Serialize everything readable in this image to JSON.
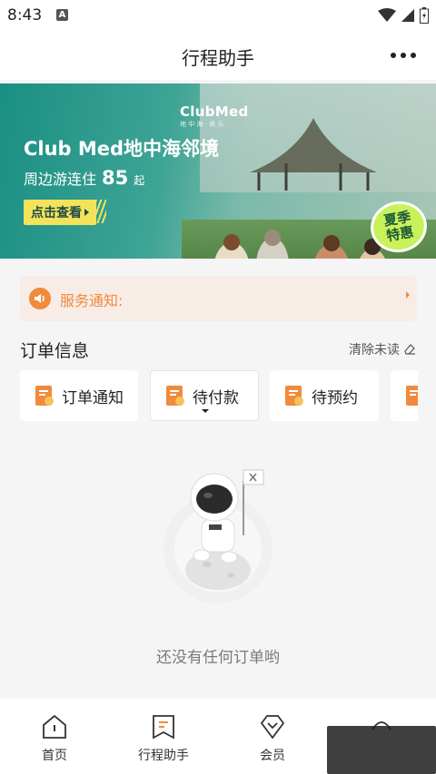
{
  "status_bar": {
    "time": "8:43",
    "notif_glyph": "A"
  },
  "header": {
    "title": "行程助手",
    "more_icon": "more-dots-icon"
  },
  "banner": {
    "brand": "ClubMed",
    "brand_sub": "地 中 海 · 俱 乐",
    "title": "Club Med地中海邻境",
    "subtitle": "周边游连住",
    "price": "85",
    "price_unit": "起",
    "cta": "点击查看",
    "badge_line1": "夏季",
    "badge_line2": "特惠"
  },
  "notice": {
    "label": "服务通知:"
  },
  "orders": {
    "title": "订单信息",
    "clear_label": "清除未读",
    "tabs": [
      {
        "label": "订单通知"
      },
      {
        "label": "待付款"
      },
      {
        "label": "待预约"
      }
    ]
  },
  "empty": {
    "text": "还没有任何订单哟"
  },
  "tabbar": {
    "items": [
      {
        "label": "首页"
      },
      {
        "label": "行程助手"
      },
      {
        "label": "会员"
      }
    ]
  },
  "colors": {
    "accent": "#f08a3c",
    "banner_teal": "#1a8f83",
    "cta_yellow": "#f4e35a"
  }
}
